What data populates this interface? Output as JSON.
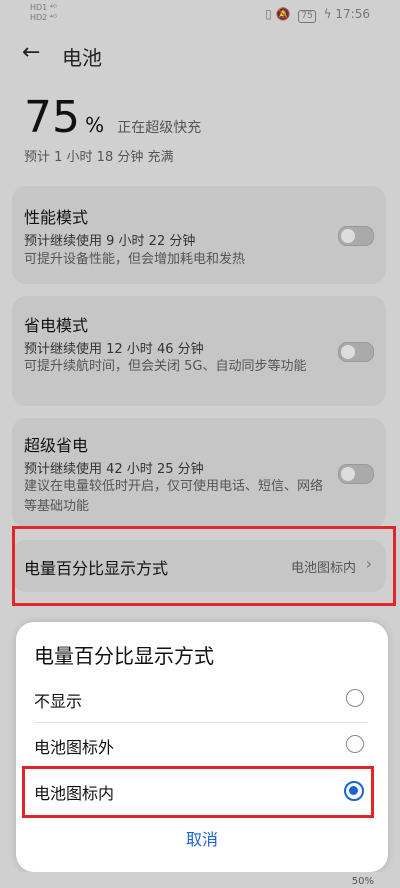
{
  "status_bar": {
    "left_top": "HD1 ⁴ᴳ",
    "left_bottom": "HD2 ⁴ᴳ",
    "battery_level": "75",
    "time": "17:56"
  },
  "header": {
    "back_icon": "back-arrow-icon",
    "title": "电池"
  },
  "battery": {
    "percent": "75",
    "percent_sign": "%",
    "state": "正在超级快充",
    "charge_estimate": "预计 1 小时 18 分钟 充满"
  },
  "modes": [
    {
      "title": "性能模式",
      "usage": "预计继续使用 9 小时 22 分钟",
      "desc": "可提升设备性能，但会增加耗电和发热",
      "enabled": false
    },
    {
      "title": "省电模式",
      "usage": "预计继续使用 12 小时 46 分钟",
      "desc": "可提升续航时间，但会关闭 5G、自动同步等功能",
      "enabled": false
    },
    {
      "title": "超级省电",
      "usage": "预计继续使用 42 小时 25 分钟",
      "desc": "建议在电量较低时开启，仅可使用电话、短信、网络等基础功能",
      "enabled": false
    }
  ],
  "percent_display": {
    "label": "电量百分比显示方式",
    "value": "电池图标内"
  },
  "dialog": {
    "title": "电量百分比显示方式",
    "options": [
      {
        "label": "不显示",
        "selected": false
      },
      {
        "label": "电池图标外",
        "selected": false
      },
      {
        "label": "电池图标内",
        "selected": true
      }
    ],
    "cancel": "取消"
  },
  "chart_hint": {
    "label": "50%"
  },
  "colors": {
    "accent": "#1a63d6",
    "highlight_box": "#e0262b"
  }
}
